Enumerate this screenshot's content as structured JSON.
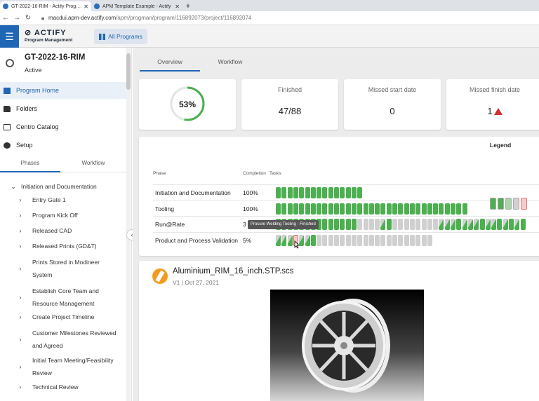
{
  "browser": {
    "tabs": [
      {
        "title": "GT-2022-16-RIM - Actify Program",
        "active": true
      },
      {
        "title": "APM Template Example - Actify",
        "active": false
      }
    ],
    "new_tab": "+",
    "url_host": "macdui.apm-dev.actify.com",
    "url_path": "/apm/progman/program/116892073/project/116892074"
  },
  "header": {
    "logo_name": "ACTIFY",
    "logo_sub": "Program Management",
    "all_programs": "All Programs"
  },
  "sidebar": {
    "project_name": "GT-2022-16-RIM",
    "project_status": "Active",
    "nav": [
      {
        "label": "Program Home",
        "icon": "chart-icon"
      },
      {
        "label": "Folders",
        "icon": "folder-icon"
      },
      {
        "label": "Centro Catalog",
        "icon": "external-link-icon"
      },
      {
        "label": "Setup",
        "icon": "gear-icon"
      }
    ],
    "tabs": [
      "Phases",
      "Workflow"
    ],
    "tree_root": "Initiation and Documentation",
    "tree_items": [
      [
        "Entry Gate 1"
      ],
      [
        "Program Kick Off"
      ],
      [
        "Released CAD"
      ],
      [
        "Released Prints (GD&T)"
      ],
      [
        "Prints Stored in Modineer",
        "System"
      ],
      [
        "Establish Core Team and",
        "Resource Management"
      ],
      [
        "Create Project Timeline"
      ],
      [
        "Customer Milestones Reviewed",
        "and Agreed"
      ],
      [
        "Initial Team Meeting/Feasibility",
        "Review"
      ],
      [
        "Technical Review"
      ]
    ]
  },
  "main": {
    "tabs": [
      "Overview",
      "Workflow"
    ],
    "progress_percent": 53,
    "progress_label": "53%",
    "cards": [
      {
        "label": "Finished",
        "value": "47/88"
      },
      {
        "label": "Missed start date",
        "value": "0"
      },
      {
        "label": "Missed finish date",
        "value": "1"
      }
    ],
    "legend_title": "Legend",
    "legend_colors": [
      "#4caf50",
      "#4caf50",
      "#a5d6a7",
      "#d0d0d0",
      "#f4cccc"
    ],
    "table_headers": {
      "phase": "Phase",
      "completion": "Completion",
      "tasks": "Tasks"
    },
    "phases": [
      {
        "name": "Initiation and Documentation",
        "completion": "100%",
        "tasks": "GGGGGGGGGGGGGGG"
      },
      {
        "name": "Tooling",
        "completion": "100%",
        "tasks": "GGGGGGGGGGGGGGGGGGGGGGGGGGGGGGGGG"
      },
      {
        "name": "Run@Rate",
        "completion": "3",
        "tasks": "GGGGGGGGGGGGGGNNNNPGNNNNNNNNPPPGPPPGPPGPGPG"
      },
      {
        "name": "Product and Process Validation",
        "completion": "5%",
        "tasks": "PPPRPPGNNNNNNNNNNNNNNNNNNNN"
      }
    ],
    "task_colors": {
      "G": "#4caf50",
      "N": "#d0d0d0",
      "P": "#8fcf8f",
      "R": "#f4cccc"
    },
    "tooltip": "Procure Welding Tooling - Finished",
    "file": {
      "name": "Aluminium_RIM_16_inch.STP.scs",
      "meta": "V1 | Oct 27, 2021"
    }
  }
}
